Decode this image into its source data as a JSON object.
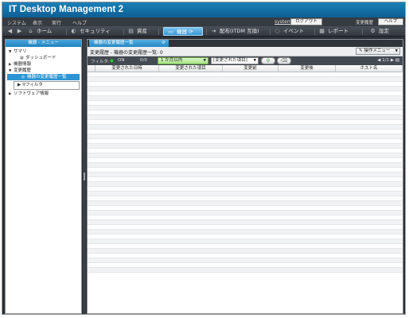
{
  "app": {
    "title": "IT Desktop Management 2"
  },
  "menu": {
    "items": [
      "システム",
      "表示",
      "実行",
      "ヘルプ"
    ],
    "user": "system",
    "logout_label": "ログアウト",
    "history_label": "変更履歴",
    "help_label": "ヘルプ"
  },
  "nav": {
    "items": [
      {
        "label": "ホーム",
        "icon": "home-icon"
      },
      {
        "label": "セキュリティ",
        "icon": "security-icon"
      },
      {
        "label": "資産",
        "icon": "asset-icon"
      },
      {
        "label": "機器",
        "icon": "device-icon",
        "active": true
      },
      {
        "label": "配布(ITDM 互換)",
        "icon": "distribution-icon"
      },
      {
        "label": "イベント",
        "icon": "event-icon"
      },
      {
        "label": "レポート",
        "icon": "report-icon"
      },
      {
        "label": "設定",
        "icon": "gear-icon"
      }
    ]
  },
  "sidebar": {
    "header": "機器 - メニュー",
    "tree": [
      {
        "label": "サマリ",
        "level": 0,
        "expanded": true
      },
      {
        "label": "ダッシュボード",
        "level": 1
      },
      {
        "label": "機器情報",
        "level": 0,
        "expanded": false
      },
      {
        "label": "変更履歴",
        "level": 0,
        "expanded": true
      },
      {
        "label": "機器の変更履歴一覧",
        "level": 1,
        "selected": true
      },
      {
        "label": "フィルタ",
        "level": 1,
        "box": true
      },
      {
        "label": "ソフトウェア情報",
        "level": 0,
        "expanded": false
      }
    ]
  },
  "main": {
    "tab_label": "機器の変更履歴一覧",
    "crumb": "変更履歴 - 機器の変更履歴一覧: 0",
    "op_menu_label": "操作メニュー",
    "filter": {
      "label": "フィルタ:",
      "state": "ON",
      "count": "0/0",
      "period": "1 か月以内",
      "field": "[変更された項目]"
    },
    "pager": "1/1",
    "columns": [
      "変更された日時",
      "変更された項目",
      "変更前",
      "変更後",
      "ホスト名"
    ]
  },
  "colors": {
    "accent": "#2b95d3",
    "titlebar": "#1b7fb8",
    "filter_on": "#3ccf3c"
  }
}
